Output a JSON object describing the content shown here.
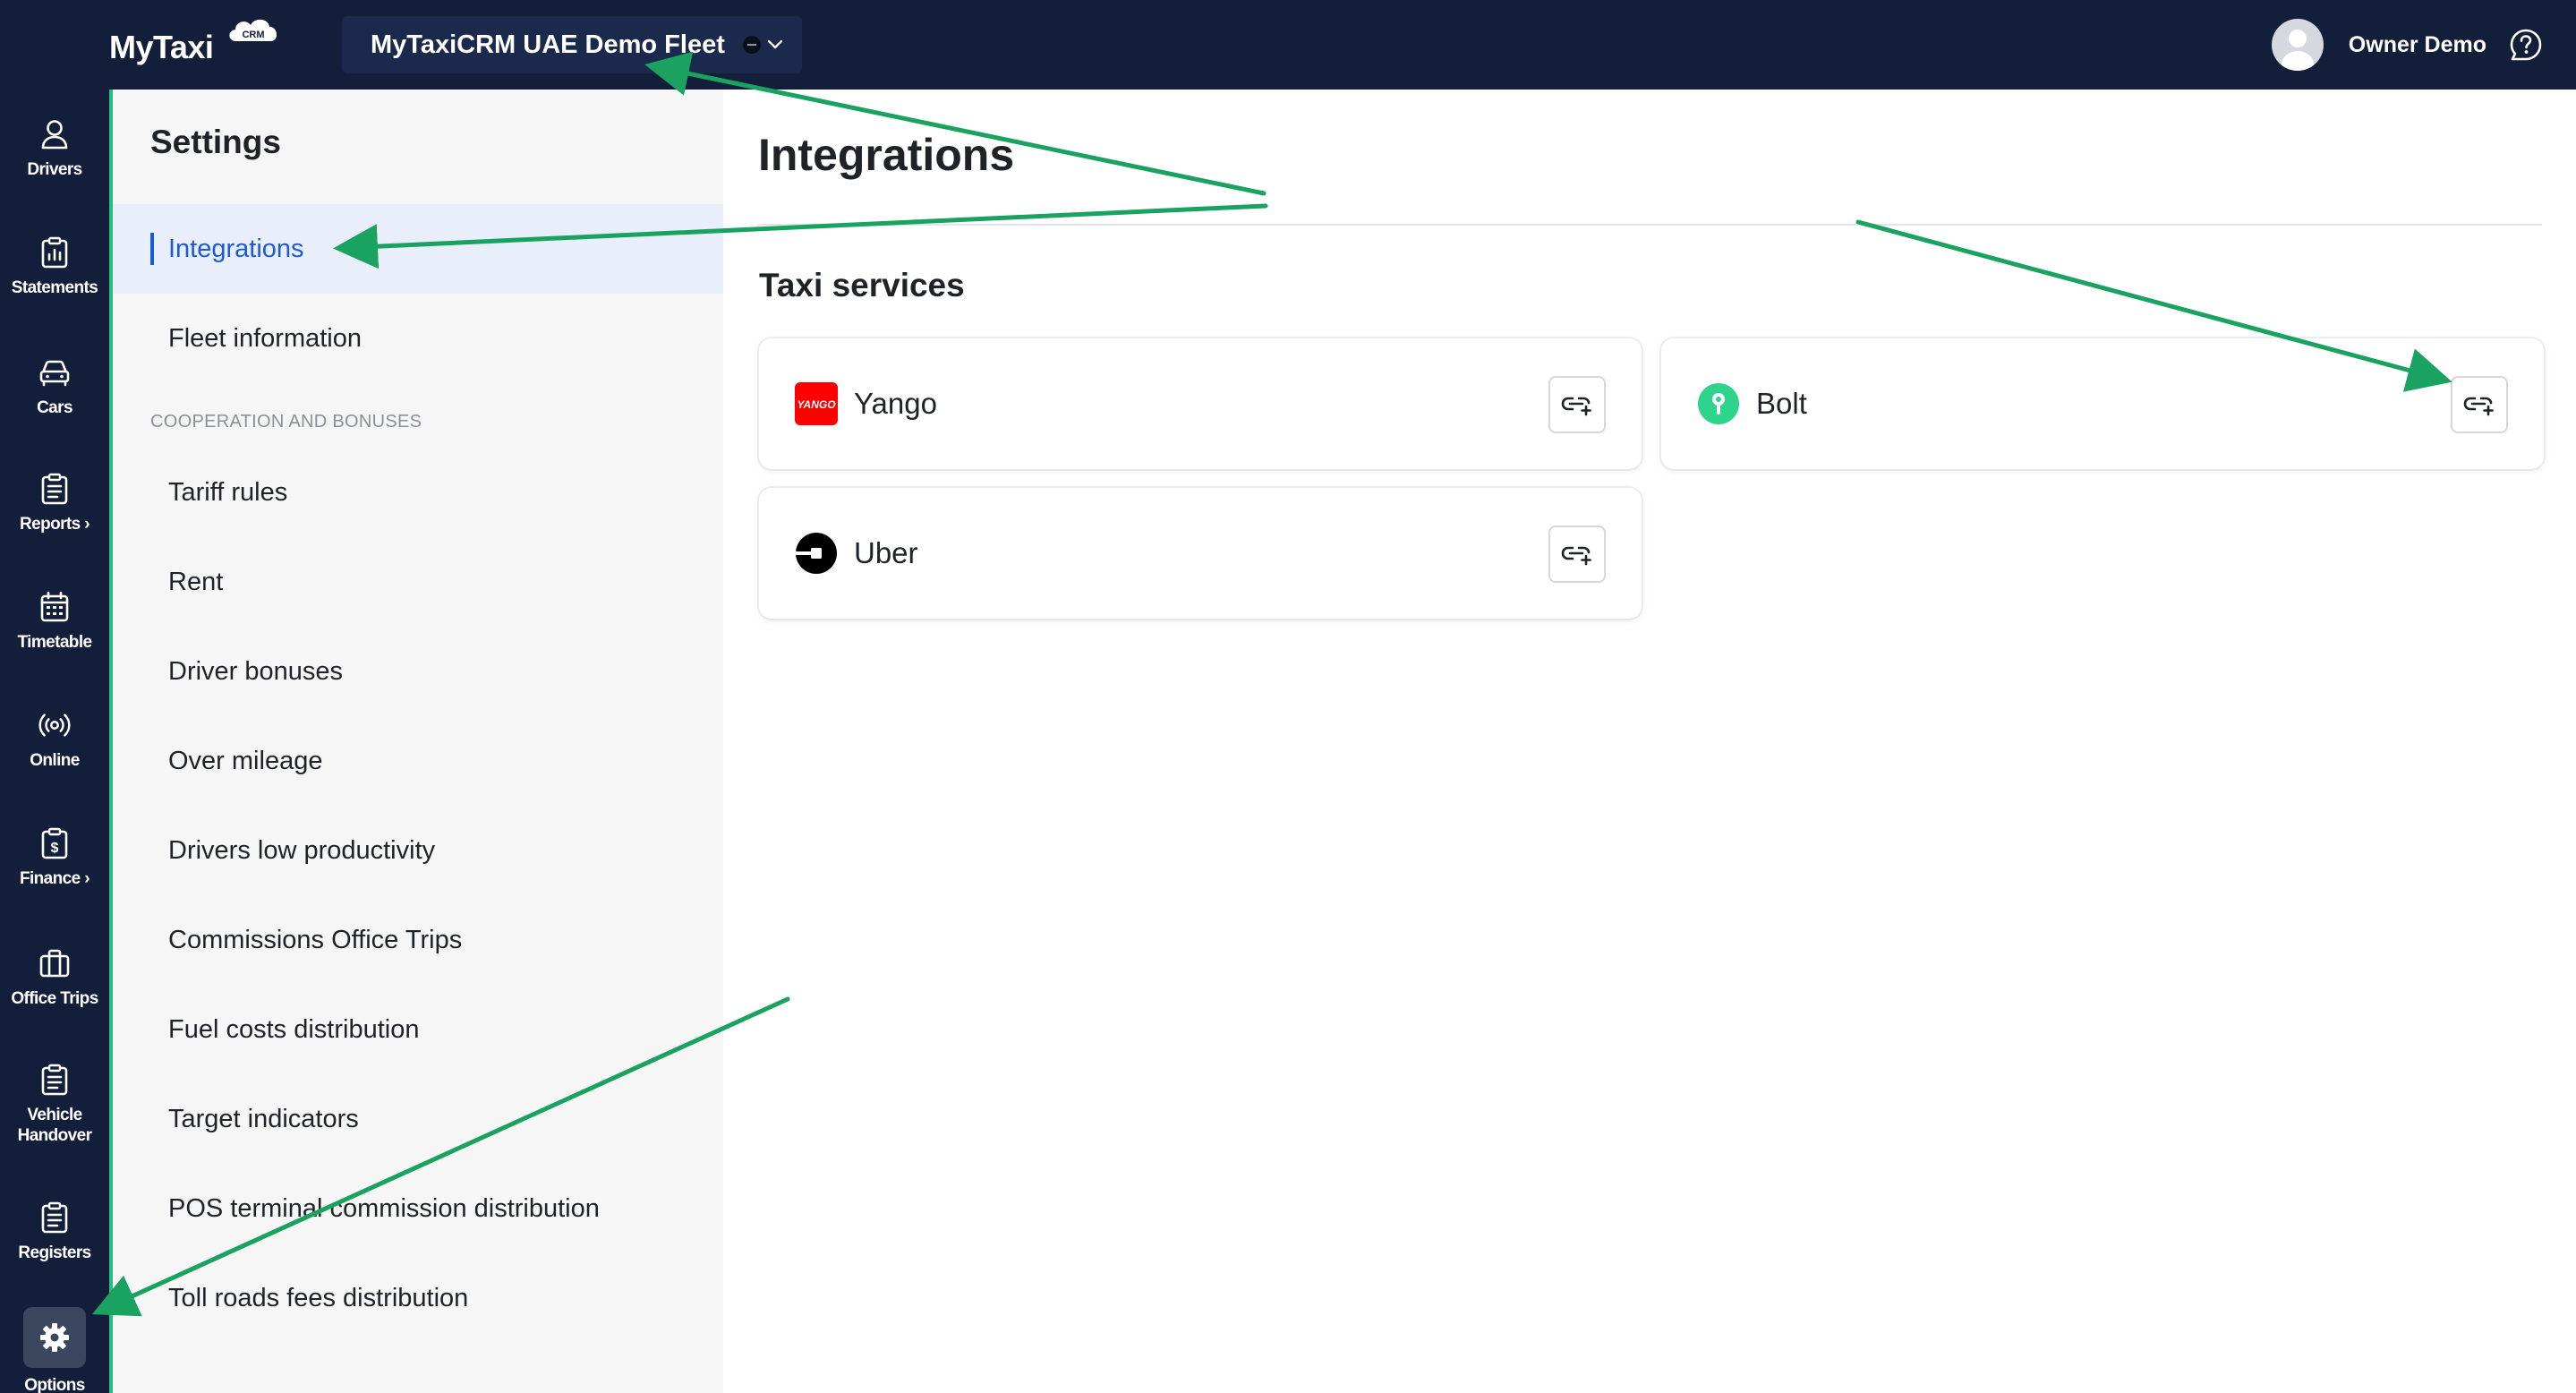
{
  "header": {
    "logo_text": "MyTaxi",
    "logo_badge": "CRM",
    "fleet_name": "MyTaxiCRM UAE Demo Fleet",
    "user_name": "Owner Demo"
  },
  "nav": {
    "items": [
      {
        "label": "Drivers",
        "icon": "user-icon"
      },
      {
        "label": "Statements",
        "icon": "clipboard-icon"
      },
      {
        "label": "Cars",
        "icon": "car-icon"
      },
      {
        "label": "Reports",
        "icon": "clipboard-list-icon",
        "chevron": true
      },
      {
        "label": "Timetable",
        "icon": "calendar-icon"
      },
      {
        "label": "Online",
        "icon": "broadcast-icon"
      },
      {
        "label": "Finance",
        "icon": "dollar-clipboard-icon",
        "chevron": true
      },
      {
        "label": "Office Trips",
        "icon": "briefcase-icon"
      },
      {
        "label": "Vehicle Handover",
        "icon": "clipboard-list-icon"
      },
      {
        "label": "Registers",
        "icon": "clipboard-list-icon"
      },
      {
        "label": "Options",
        "icon": "gear-icon",
        "active": true
      }
    ]
  },
  "settings": {
    "title": "Settings",
    "active": "Integrations",
    "group_label": "COOPERATION AND BONUSES",
    "top_items": [
      "Integrations",
      "Fleet information"
    ],
    "group_items": [
      "Tariff rules",
      "Rent",
      "Driver bonuses",
      "Over mileage",
      "Drivers low productivity",
      "Commissions Office Trips",
      "Fuel costs distribution",
      "Target indicators",
      "POS terminal commission distribution",
      "Toll roads fees distribution"
    ]
  },
  "main": {
    "title": "Integrations",
    "section": "Taxi services",
    "services": [
      {
        "name": "Yango",
        "logo_text": "YANGO",
        "color": "#ff0000"
      },
      {
        "name": "Bolt",
        "color": "#2ed38c"
      },
      {
        "name": "Uber",
        "color": "#000000"
      }
    ]
  },
  "colors": {
    "topbar": "#131f3a",
    "accent_green": "#2bbd7e",
    "active_blue": "#1d5ad6",
    "arrow_green": "#1aa260"
  }
}
